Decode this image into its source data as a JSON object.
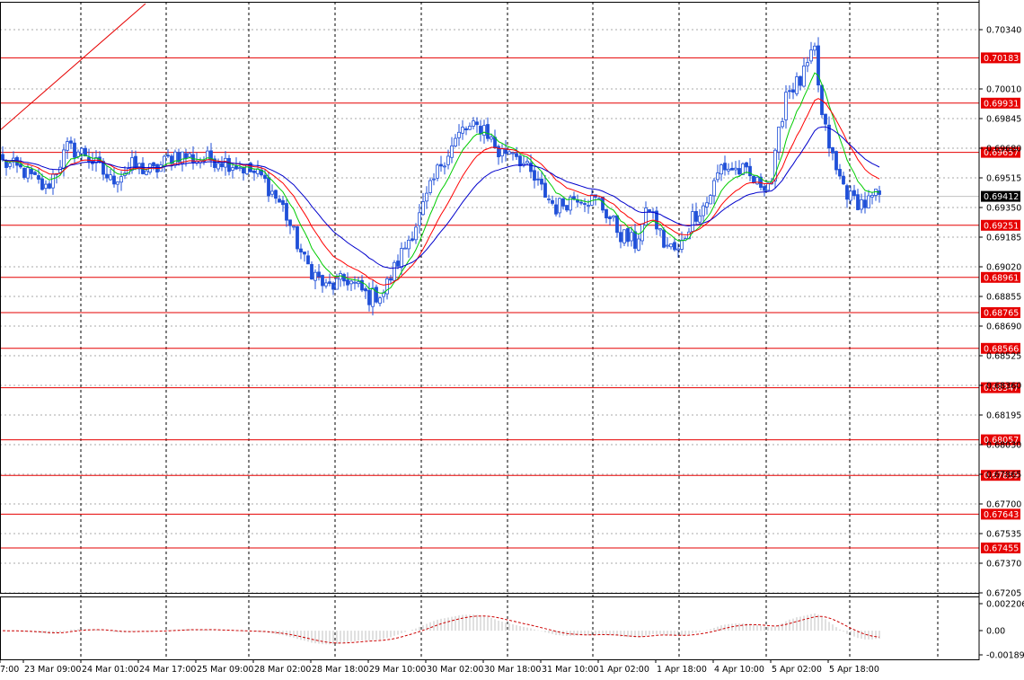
{
  "chart_data": {
    "type": "candlestick",
    "main_axis": {
      "ticks": [
        "0.70340",
        "0.70010",
        "0.69845",
        "0.69680",
        "0.69515",
        "0.69350",
        "0.69185",
        "0.69020",
        "0.68855",
        "0.68690",
        "0.68525",
        "0.68360",
        "0.68195",
        "0.68030",
        "0.67865",
        "0.67700",
        "0.67535",
        "0.67370",
        "0.67205"
      ],
      "ylim": [
        0.67205,
        0.7034
      ],
      "current_price": "0.69412"
    },
    "levels": [
      "0.70183",
      "0.69931",
      "0.69657",
      "0.69251",
      "0.68961",
      "0.68765",
      "0.68566",
      "0.68347",
      "0.68057",
      "0.67859",
      "0.67643",
      "0.67455"
    ],
    "time_axis": [
      "7:00",
      "23 Mar 09:00",
      "24 Mar 01:00",
      "24 Mar 17:00",
      "25 Mar 09:00",
      "28 Mar 02:00",
      "28 Mar 18:00",
      "29 Mar 10:00",
      "30 Mar 02:00",
      "30 Mar 18:00",
      "31 Mar 10:00",
      "1 Apr 02:00",
      "1 Apr 18:00",
      "4 Apr 10:00",
      "5 Apr 02:00",
      "5 Apr 18:00"
    ],
    "price_series": {
      "bars": 245,
      "anchors": [
        [
          0,
          0.696
        ],
        [
          6,
          0.6955
        ],
        [
          12,
          0.6945
        ],
        [
          18,
          0.6968
        ],
        [
          23,
          0.6965
        ],
        [
          30,
          0.695
        ],
        [
          36,
          0.6958
        ],
        [
          42,
          0.6955
        ],
        [
          48,
          0.6965
        ],
        [
          54,
          0.6962
        ],
        [
          60,
          0.6962
        ],
        [
          66,
          0.6958
        ],
        [
          72,
          0.6952
        ],
        [
          78,
          0.6935
        ],
        [
          84,
          0.6905
        ],
        [
          90,
          0.689
        ],
        [
          96,
          0.6895
        ],
        [
          102,
          0.6885
        ],
        [
          106,
          0.6888
        ],
        [
          110,
          0.6905
        ],
        [
          116,
          0.693
        ],
        [
          122,
          0.696
        ],
        [
          128,
          0.6978
        ],
        [
          134,
          0.698
        ],
        [
          138,
          0.6965
        ],
        [
          142,
          0.6968
        ],
        [
          148,
          0.695
        ],
        [
          154,
          0.6935
        ],
        [
          160,
          0.6942
        ],
        [
          166,
          0.6938
        ],
        [
          172,
          0.692
        ],
        [
          176,
          0.6915
        ],
        [
          180,
          0.6935
        ],
        [
          184,
          0.6915
        ],
        [
          188,
          0.691
        ],
        [
          192,
          0.693
        ],
        [
          196,
          0.6938
        ],
        [
          200,
          0.6958
        ],
        [
          206,
          0.6955
        ],
        [
          210,
          0.6948
        ],
        [
          214,
          0.695
        ],
        [
          218,
          0.7
        ],
        [
          222,
          0.7005
        ],
        [
          226,
          0.7022
        ],
        [
          228,
          0.6985
        ],
        [
          232,
          0.6955
        ],
        [
          236,
          0.694
        ],
        [
          240,
          0.6937
        ],
        [
          244,
          0.6942
        ]
      ]
    },
    "moving_averages": [
      {
        "color": "#00cc00",
        "period": 8
      },
      {
        "color": "#ff0000",
        "period": 16
      },
      {
        "color": "#0000cc",
        "period": 30
      }
    ],
    "indicator": {
      "ticks": [
        "0.002206",
        "0.00",
        "-0.001899"
      ],
      "ylim": [
        -0.001899,
        0.002206
      ],
      "histogram_color": "#c0c0c0",
      "signal_color": "#cc0000"
    },
    "colors": {
      "candle": "#1f4fd8",
      "level": "#e60000",
      "grid": "#a9a9a9",
      "trend": "#e60000"
    }
  }
}
